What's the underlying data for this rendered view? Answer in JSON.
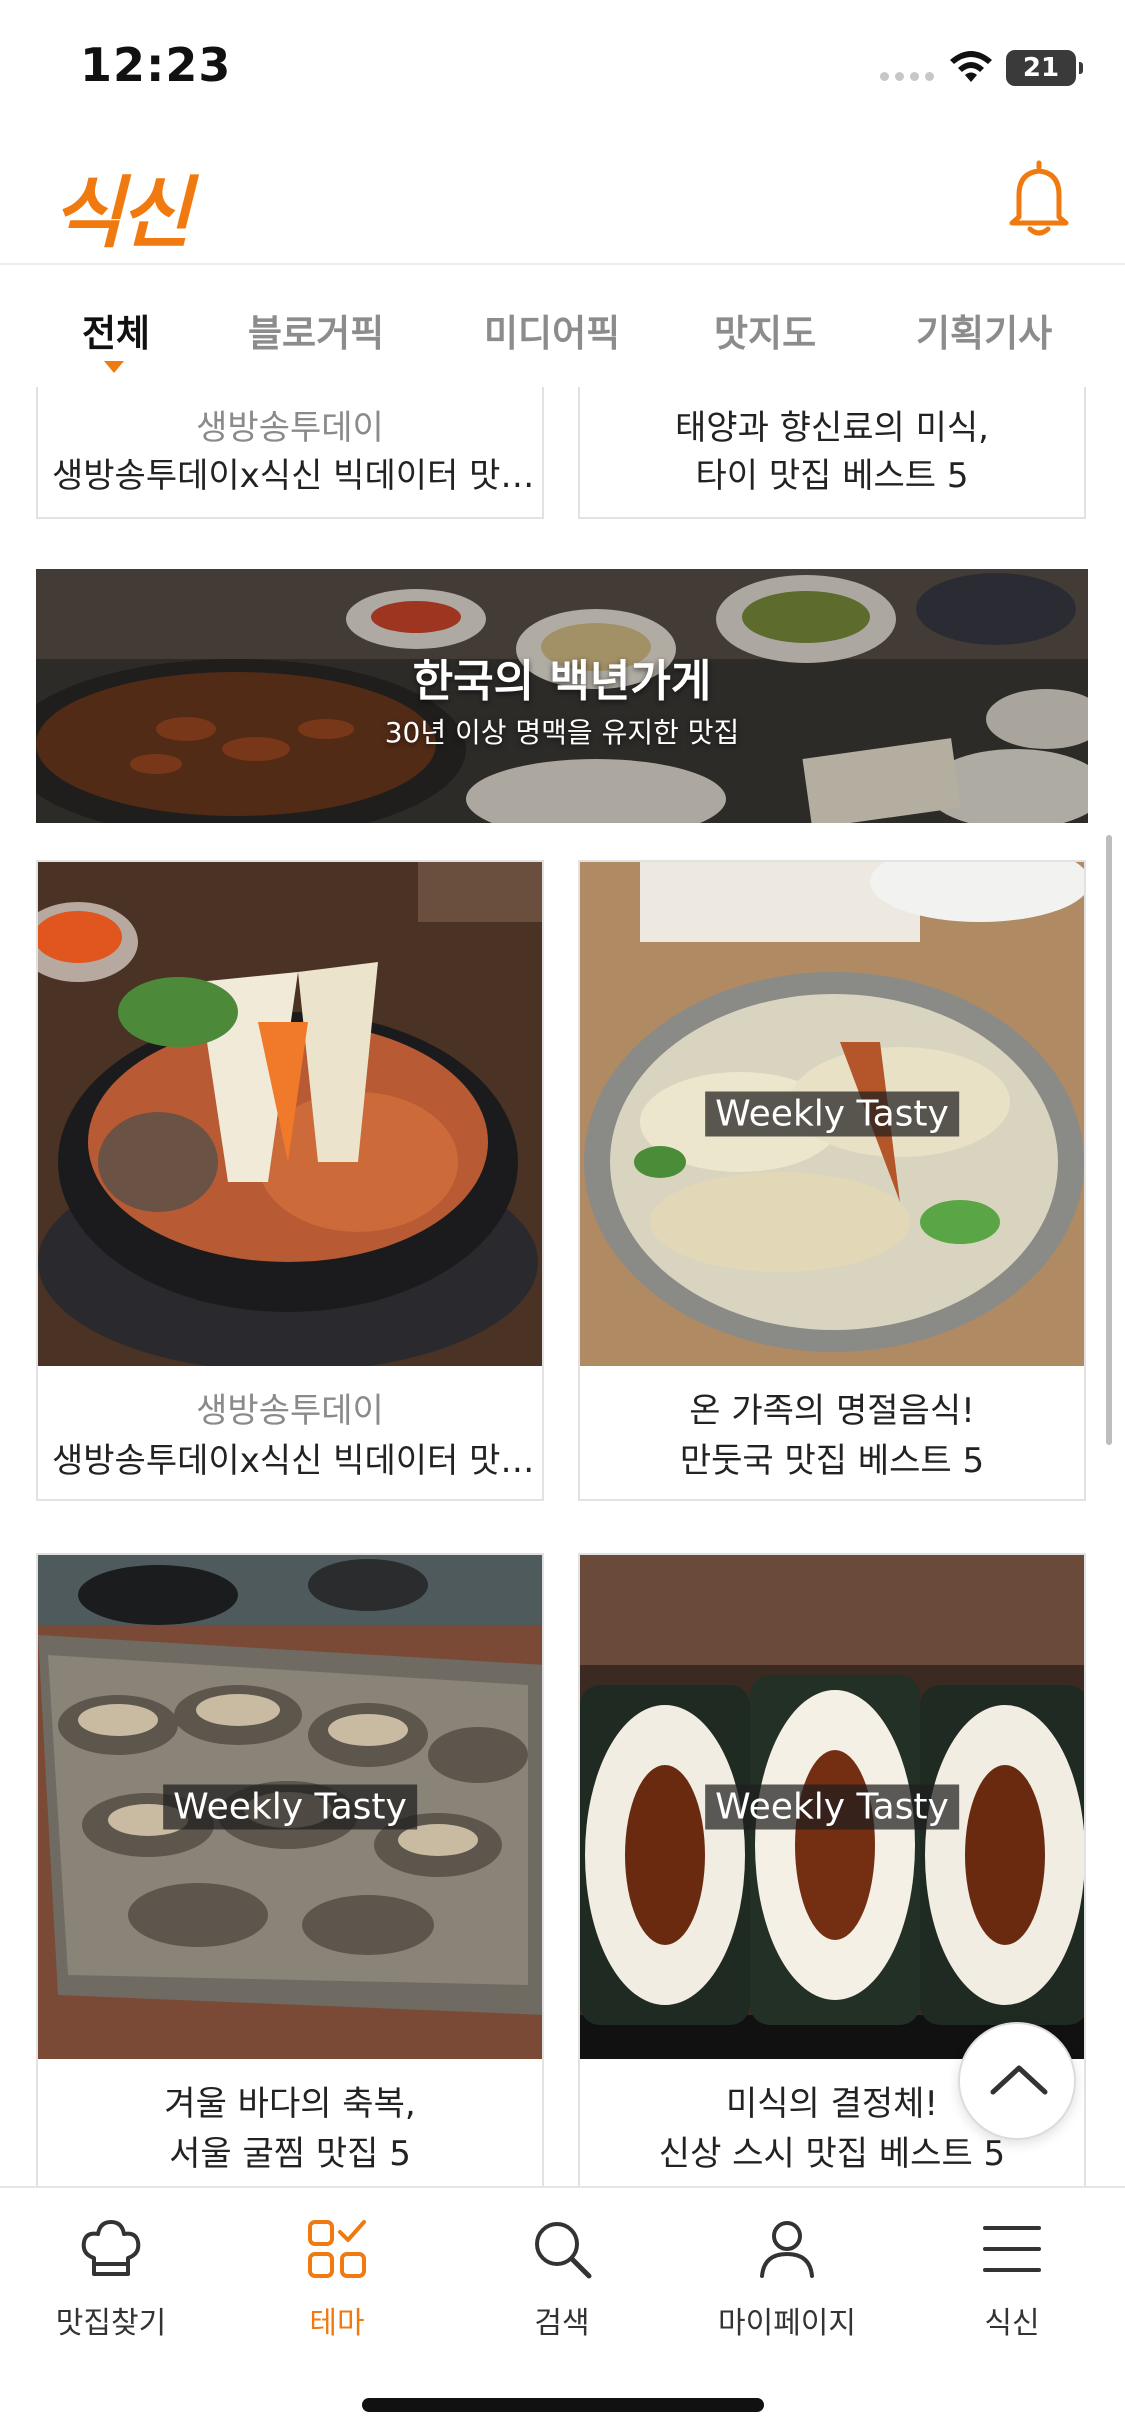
{
  "status_bar": {
    "time": "12:23",
    "battery": "21"
  },
  "header": {
    "logo": "식신",
    "notification_icon": "bell-icon"
  },
  "tabs": [
    {
      "label": "전체",
      "active": true
    },
    {
      "label": "블로거픽"
    },
    {
      "label": "미디어픽"
    },
    {
      "label": "맛지도"
    },
    {
      "label": "기획기사"
    }
  ],
  "feed": {
    "top_cards": [
      {
        "subtitle": "생방송투데이",
        "title": "생방송투데이x식신 빅데이터 맛…"
      },
      {
        "title_line1": "태양과 향신료의 미식,",
        "title_line2": "타이 맛집 베스트 5"
      }
    ],
    "banner": {
      "title": "한국의 백년가게",
      "subtitle": "30년 이상 명맥을 유지한 맛집"
    },
    "cards": [
      {
        "subtitle": "생방송투데이",
        "title": "생방송투데이x식신 빅데이터 맛…"
      },
      {
        "badge": "Weekly Tasty",
        "title_line1": "온 가족의 명절음식!",
        "title_line2": "만둣국 맛집 베스트 5"
      },
      {
        "badge": "Weekly Tasty",
        "title_line1": "겨울 바다의 축복,",
        "title_line2": "서울 굴찜 맛집 5"
      },
      {
        "badge": "Weekly Tasty",
        "title_line1": "미식의 결정체!",
        "title_line2": "신상 스시 맛집 베스트 5"
      }
    ]
  },
  "bottom_nav": [
    {
      "label": "맛집찾기",
      "icon": "chef-hat-icon"
    },
    {
      "label": "테마",
      "icon": "theme-grid-icon",
      "active": true
    },
    {
      "label": "검색",
      "icon": "search-icon"
    },
    {
      "label": "마이페이지",
      "icon": "person-icon"
    },
    {
      "label": "식신",
      "icon": "menu-icon"
    }
  ],
  "colors": {
    "accent": "#f07a10",
    "text": "#222222",
    "muted": "#8a8a8a"
  }
}
